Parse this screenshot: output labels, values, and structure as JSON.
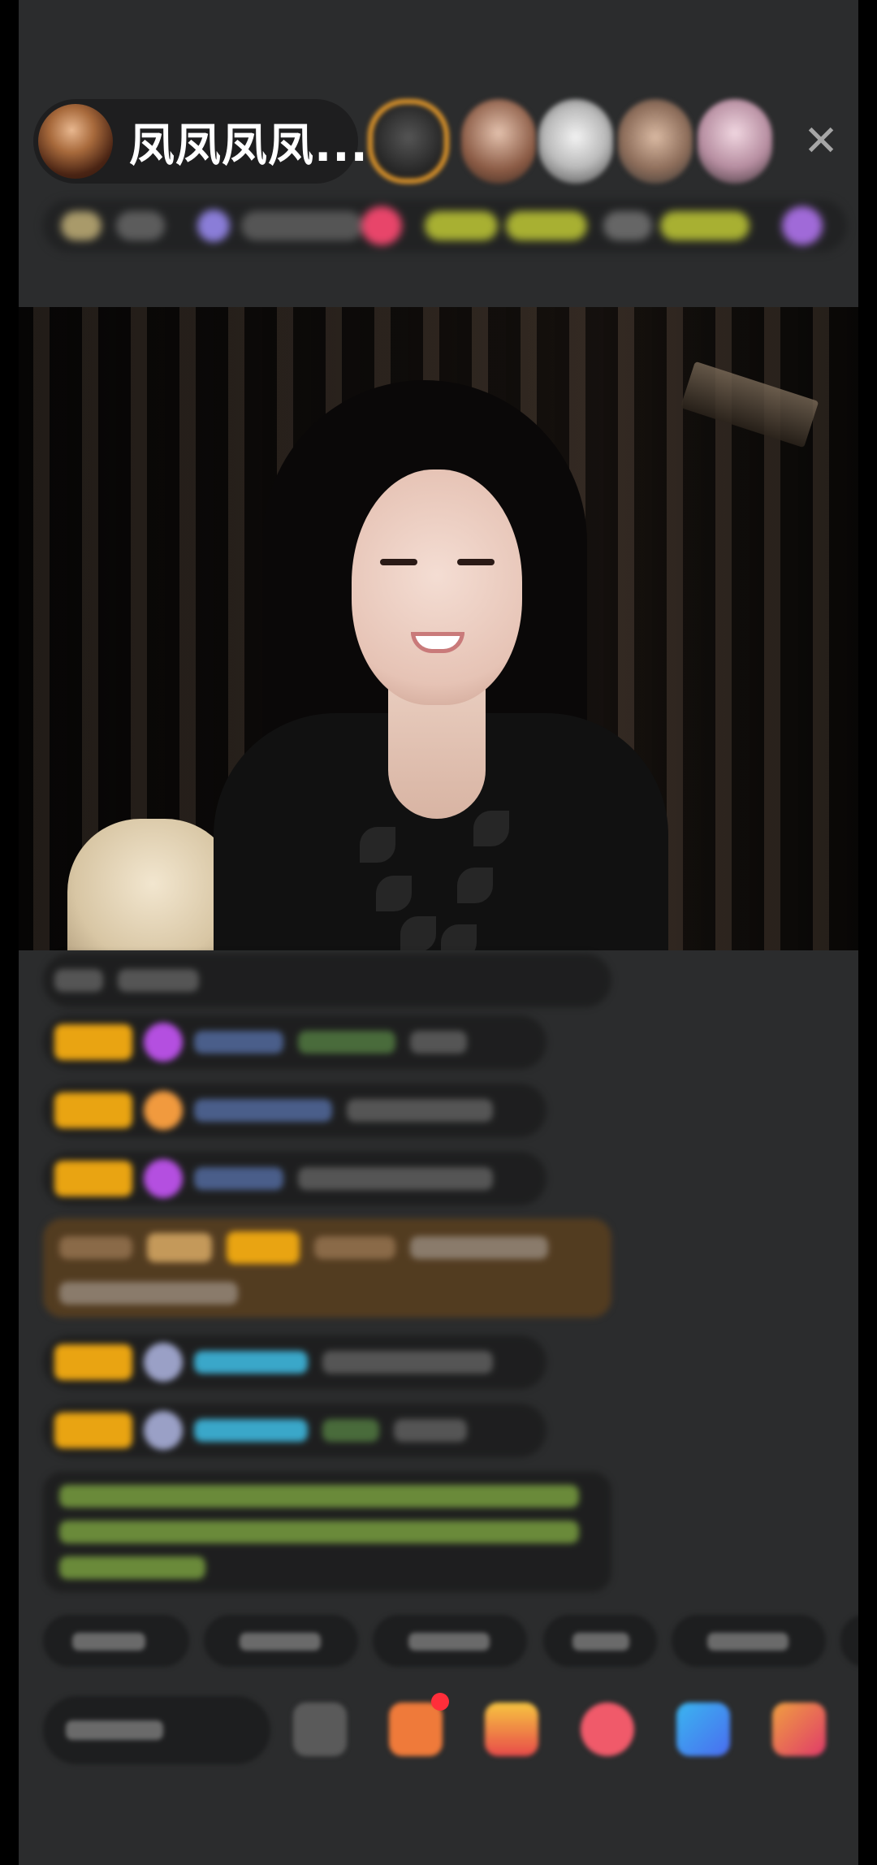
{
  "host": {
    "name": "凤凤凤凤...",
    "avatar_icon": "host-avatar"
  },
  "top_viewers": [
    "viewer-avatar-1",
    "viewer-avatar-2",
    "viewer-avatar-3",
    "viewer-avatar-4",
    "viewer-avatar-5"
  ],
  "close_icon": "close-icon",
  "colors": {
    "background": "#2b2c2d",
    "badge_gold": "#e9a412",
    "rank_border": "#e89b2a",
    "username_blue": "#3aa7c9",
    "chat_green": "#8fcc4a",
    "notification_red": "#ff2e3a"
  },
  "bottom_bar": {
    "tool_icons": [
      "more-icon",
      "gift-box-icon",
      "shop-icon",
      "heart-icon",
      "game-icon",
      "gift-icon"
    ]
  }
}
